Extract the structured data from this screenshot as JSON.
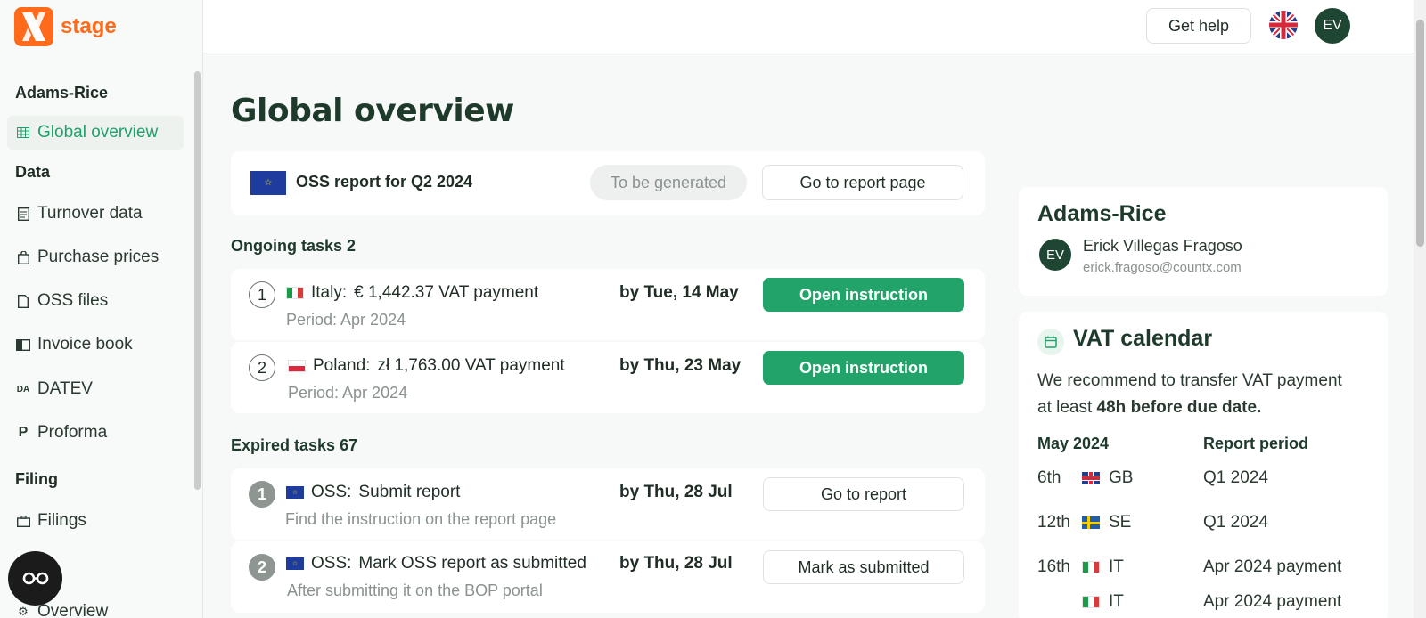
{
  "brand": {
    "name": "stage",
    "color": "#ff6b1a"
  },
  "sidebar": {
    "client": "Adams-Rice",
    "sections": {
      "data": "Data",
      "filing": "Filing"
    },
    "items": [
      {
        "label": "Global overview",
        "icon": "grid-icon"
      },
      {
        "label": "Turnover data",
        "icon": "document-list-icon"
      },
      {
        "label": "Purchase prices",
        "icon": "shopping-bag-icon"
      },
      {
        "label": "OSS files",
        "icon": "file-icon"
      },
      {
        "label": "Invoice book",
        "icon": "book-icon"
      },
      {
        "label": "DATEV",
        "icon": "datev-icon"
      },
      {
        "label": "Proforma",
        "icon": "proforma-icon"
      },
      {
        "label": "Filings",
        "icon": "briefcase-icon"
      },
      {
        "label": "Overview",
        "icon": "gear-icon"
      }
    ]
  },
  "topbar": {
    "help_label": "Get help",
    "avatar_initials": "EV"
  },
  "page": {
    "title": "Global overview"
  },
  "oss": {
    "title": "OSS report for Q2 2024",
    "status": "To be generated",
    "button": "Go to report page"
  },
  "ongoing": {
    "label": "Ongoing tasks 2",
    "tasks": [
      {
        "num": "1",
        "country": "Italy:",
        "text": "€ 1,442.37 VAT payment",
        "sub": "Period: Apr 2024",
        "due": "by Tue, 14 May",
        "button": "Open instruction"
      },
      {
        "num": "2",
        "country": "Poland:",
        "text": "zł 1,763.00 VAT payment",
        "sub": "Period: Apr 2024",
        "due": "by Thu, 23 May",
        "button": "Open instruction"
      }
    ]
  },
  "expired": {
    "label": "Expired tasks 67",
    "tasks": [
      {
        "num": "1",
        "country": "OSS:",
        "text": "Submit report",
        "sub": "Find the instruction on the report page",
        "due": "by Thu, 28 Jul",
        "button": "Go to report"
      },
      {
        "num": "2",
        "country": "OSS:",
        "text": "Mark OSS report as submitted",
        "sub": "After submitting it on the BOP portal",
        "due": "by Thu, 28 Jul",
        "button": "Mark as submitted"
      }
    ]
  },
  "profile": {
    "company": "Adams-Rice",
    "initials": "EV",
    "name": "Erick Villegas Fragoso",
    "email": "erick.fragoso@countx.com"
  },
  "vat_calendar": {
    "title": "VAT calendar",
    "line1": "We recommend to transfer VAT payment",
    "line2_prefix": "at least",
    "line2_bold": "48h before due date.",
    "col_month": "May 2024",
    "col_period": "Report period",
    "rows": [
      {
        "day": "6th",
        "country": "GB",
        "period": "Q1 2024"
      },
      {
        "day": "12th",
        "country": "SE",
        "period": "Q1 2024"
      },
      {
        "day": "16th",
        "country": "IT",
        "period": "Apr 2024 payment"
      },
      {
        "day": "",
        "country": "IT",
        "period": "Apr 2024 payment"
      }
    ]
  }
}
